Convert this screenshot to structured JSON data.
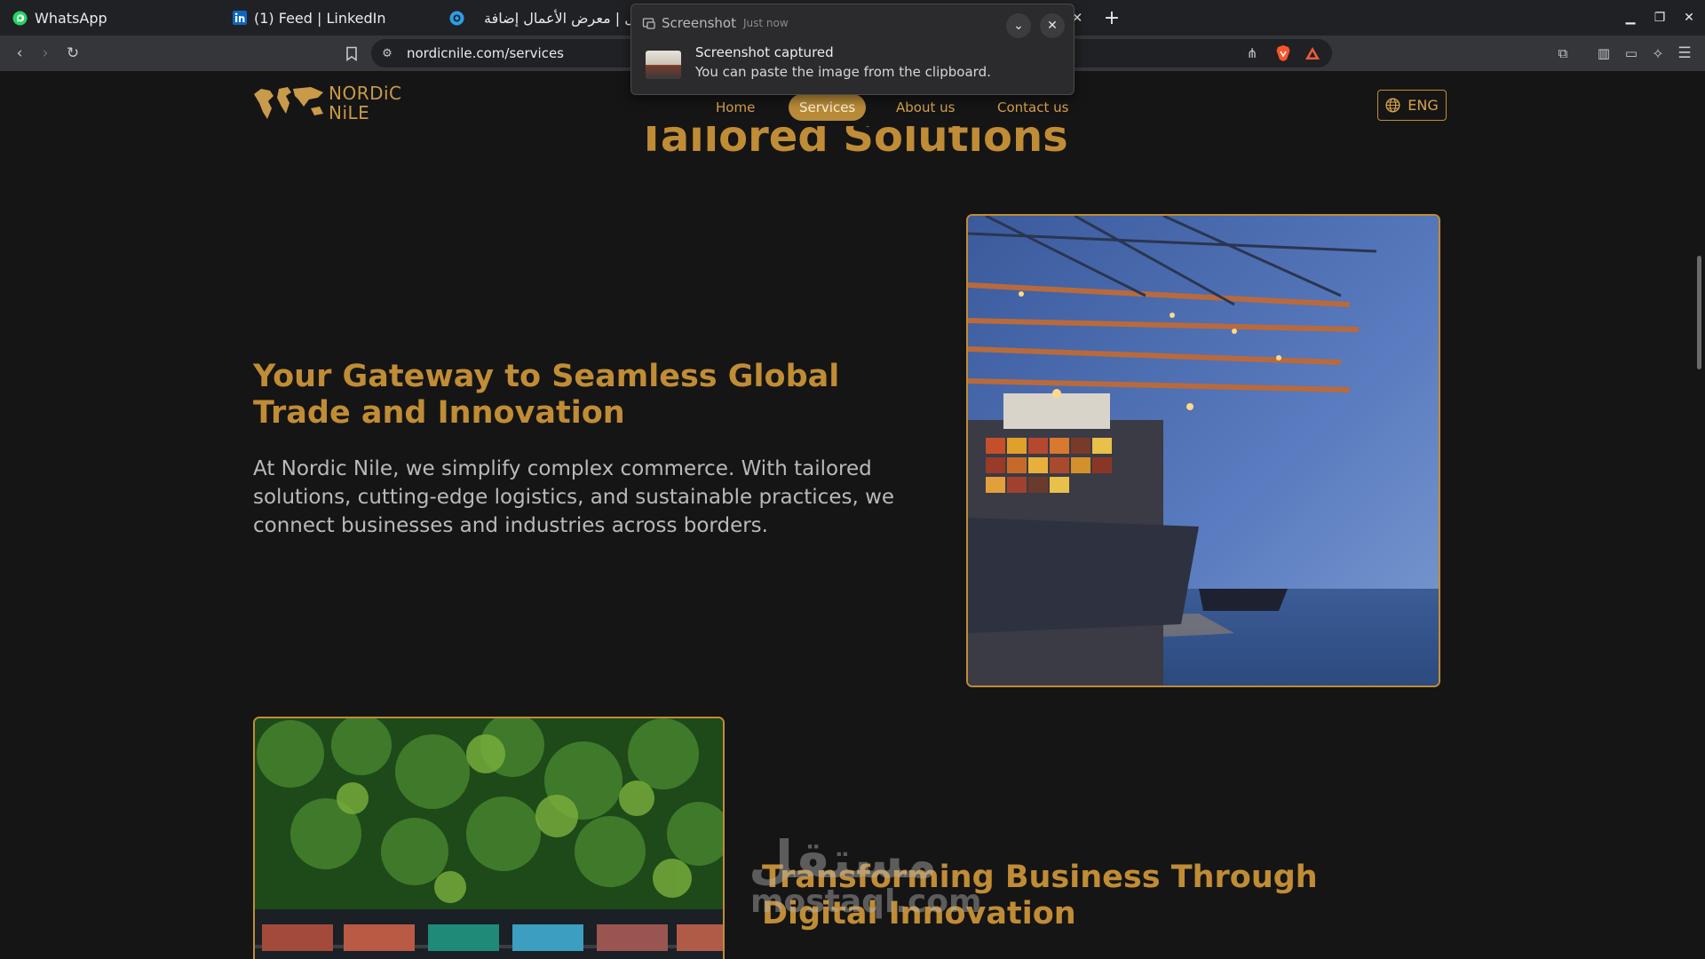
{
  "tabs": [
    {
      "title": "WhatsApp",
      "icon": "whatsapp-icon"
    },
    {
      "title": "(1) Feed | LinkedIn",
      "icon": "linkedin-icon"
    },
    {
      "title": "مستقل | معرض الأعمال إضافة",
      "icon": "mostaql-icon"
    }
  ],
  "address_bar": {
    "url": "nordicnile.com/services"
  },
  "toast": {
    "app_label": "Screenshot",
    "time": "Just now",
    "title": "Screenshot captured",
    "message": "You can paste the image from the clipboard."
  },
  "site": {
    "logo_line1": "NORDiC",
    "logo_line2": "NiLE",
    "nav": [
      {
        "label": "Home",
        "active": false
      },
      {
        "label": "Services",
        "active": true
      },
      {
        "label": "About us",
        "active": false
      },
      {
        "label": "Contact us",
        "active": false
      }
    ],
    "language": "ENG",
    "hero_title": "Tailored Solutions",
    "section1": {
      "title": "Your Gateway to Seamless Global Trade and Innovation",
      "body": "At Nordic Nile, we simplify complex commerce. With tailored solutions, cutting-edge logistics, and sustainable practices, we connect businesses and industries across borders."
    },
    "section2": {
      "title": "Transforming Business Through Digital Innovation"
    },
    "watermark": {
      "arabic": "مستقل",
      "latin": "mostaql.com"
    }
  },
  "colors": {
    "accent": "#c08c35",
    "page_bg": "#151515",
    "chrome_bg": "#202124",
    "toolbar_bg": "#35363a"
  }
}
